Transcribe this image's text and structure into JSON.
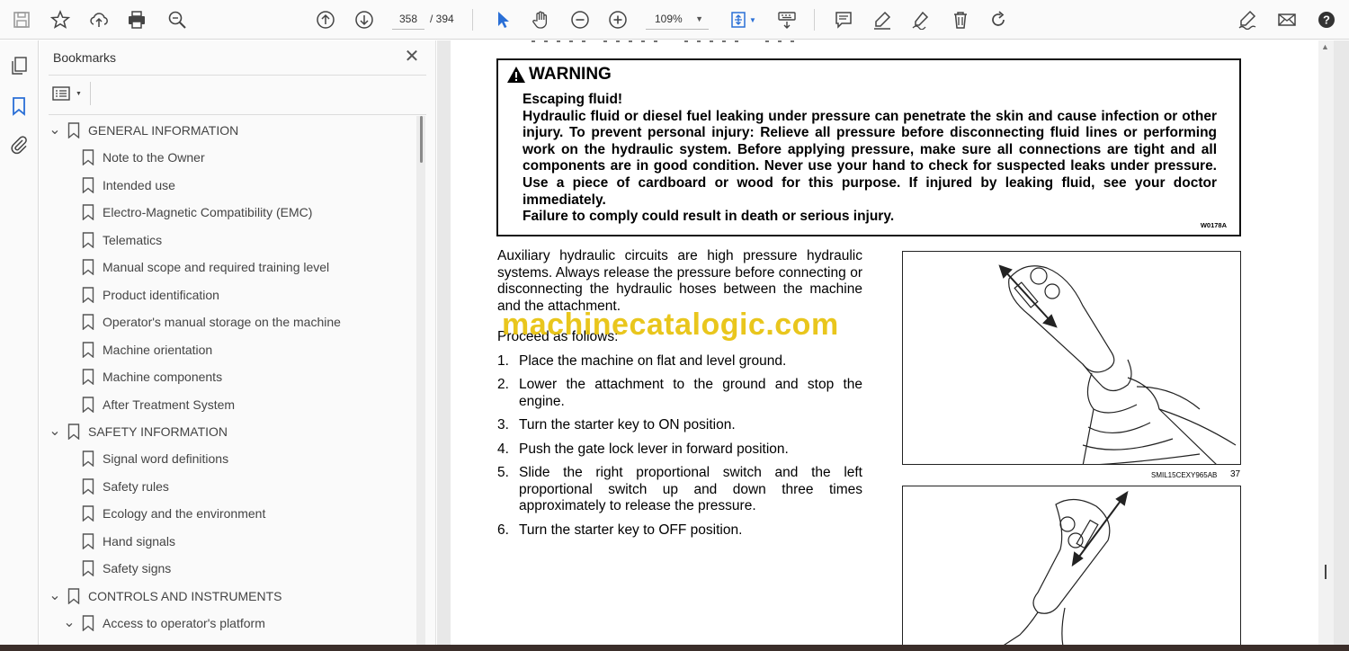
{
  "toolbar": {
    "page_current": "358",
    "page_total": "/ 394",
    "zoom": "109%"
  },
  "bookmarks": {
    "title": "Bookmarks",
    "items": [
      {
        "label": "GENERAL INFORMATION",
        "level": 0,
        "expanded": true
      },
      {
        "label": "Note to the Owner",
        "level": 1
      },
      {
        "label": "Intended use",
        "level": 1
      },
      {
        "label": "Electro-Magnetic Compatibility (EMC)",
        "level": 1
      },
      {
        "label": "Telematics",
        "level": 1
      },
      {
        "label": "Manual scope and required training level",
        "level": 1
      },
      {
        "label": "Product identification",
        "level": 1
      },
      {
        "label": "Operator's manual storage on the machine",
        "level": 1
      },
      {
        "label": "Machine orientation",
        "level": 1
      },
      {
        "label": "Machine components",
        "level": 1
      },
      {
        "label": "After Treatment System",
        "level": 1
      },
      {
        "label": "SAFETY INFORMATION",
        "level": 0,
        "expanded": true
      },
      {
        "label": "Signal word definitions",
        "level": 1
      },
      {
        "label": "Safety rules",
        "level": 1
      },
      {
        "label": "Ecology and the environment",
        "level": 1
      },
      {
        "label": "Hand signals",
        "level": 1
      },
      {
        "label": "Safety signs",
        "level": 1
      },
      {
        "label": "CONTROLS AND INSTRUMENTS",
        "level": 0,
        "expanded": true
      },
      {
        "label": "Access to operator's platform",
        "level": 1,
        "expanded": true
      }
    ]
  },
  "document": {
    "warning": {
      "title": "WARNING",
      "body": "Escaping fluid!\nHydraulic fluid or diesel fuel leaking under pressure can penetrate the skin and cause infection or other injury. To prevent personal injury: Relieve all pressure before disconnecting fluid lines or performing work on the hydraulic system. Before applying pressure, make sure all connections are tight and all components are in good condition. Never use your hand to check for suspected leaks under pressure. Use a piece of cardboard or wood for this purpose. If injured by leaking fluid, see your doctor immediately.\nFailure to comply could result in death or serious injury.",
      "code": "W0178A"
    },
    "intro": "Auxiliary hydraulic circuits are high pressure hydraulic systems. Always release the pressure before connecting or disconnecting the hydraulic hoses between the machine and the attachment.",
    "watermark": "machinecatalogic.com",
    "proceed": "Proceed as follows:",
    "steps": [
      {
        "num": "1.",
        "text": "Place the machine on flat and level ground."
      },
      {
        "num": "2.",
        "text": "Lower the attachment to the ground and stop the engine."
      },
      {
        "num": "3.",
        "text": "Turn the starter key to ON position."
      },
      {
        "num": "4.",
        "text": "Push the gate lock lever in forward position."
      },
      {
        "num": "5.",
        "text": "Slide the right proportional switch and the left proportional switch up and down three times approximately to release the pressure."
      },
      {
        "num": "6.",
        "text": "Turn the starter key to OFF position."
      }
    ],
    "figure1": {
      "caption": "SMIL15CEXY965AB",
      "number": "37"
    }
  },
  "colors": {
    "watermark": "#e8c20a",
    "accent_blue": "#2a6fd6"
  }
}
